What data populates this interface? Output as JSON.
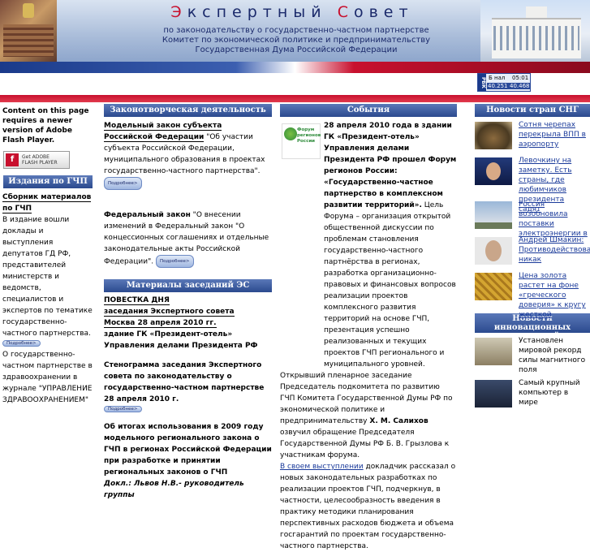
{
  "header": {
    "title_a": "Э",
    "title_mid": "кспертный ",
    "title_b": "С",
    "title_end": "овет",
    "sub1": "по законодательству о государственно-частном партнерстве",
    "sub2": "Комитет по экономической политике и предпринимательству",
    "sub3": "Государственная Дума Российской Федерации"
  },
  "ticker": {
    "logo": "РБК",
    "c1": "Б нал",
    "c2": "05:01",
    "c3": "40.251",
    "c4": "40.468"
  },
  "more_label": "Подробнее>",
  "left": {
    "flash_text": "Content on this page requires a newer version of Adobe Flash Player.",
    "get_flash_1": "Get ADOBE",
    "get_flash_2": "FLASH PLAYER",
    "header": "Издания по ГЧП",
    "item1_title": "Сборник материалов по ГЧП",
    "item1_text": "В издание вошли доклады и выступления депутатов ГД РФ, представителей министерств и ведомств, специалистов и экспертов по тематике государственно-частного партнерства.",
    "item2_text": "О государственно-частном партнерстве в здравоохранении в журнале \"УПРАВЛЕНИЕ ЗДРАВООХРАНЕНИЕМ\""
  },
  "col2": {
    "header": "Законотворческая деятельность",
    "law1_bold": "Модельный закон субъекта Российской Федерации",
    "law1_text": " \"Об участии субъекта Российской Федерации, муниципального образования в проектах государственно-частного партнерства\".",
    "law2_bold": "Федеральный закон",
    "law2_text": " \"О внесении изменений в Федеральный закон \"О концессионных соглашениях и отдельные законодательные акты Российской Федерации\".",
    "header2": "Материалы заседаний ЭС",
    "agenda_title": "ПОВЕСТКА ДНЯ",
    "agenda_l1": "заседания Экспертного совета",
    "agenda_l2": "Москва 28 апреля 2010 гг.",
    "agenda_l3": "здание ГК «Президент-отель» Управления делами Президента РФ",
    "steno": "Стенограмма заседания Экспертного совета по законодательству о государственно-частном партнерстве 28 апреля 2010 г.",
    "results": "Об итогах использования в 2009 году модельного регионального закона о ГЧП в регионах Российской Федерации при разработке и принятии региональных законов о ГЧП",
    "report": "Докл.: Львов Н.В.- руководитель группы"
  },
  "col3": {
    "header": "События",
    "forum_logo": "Форум регионов России",
    "event_bold": "28 апреля 2010 года в здании ГК «Президент-отель» Управления делами Президента РФ прошел Форум регионов России: «Государственно-частное партнерство в комплексном развитии территорий».",
    "event_text": " Цель Форума – организация открытой общественной дискуссии по проблемам становления государственно-частного партнёрства в регионах, разработка организационно-правовых и финансовых вопросов реализации проектов комплексного развития территорий на основе ГЧП, презентация успешно реализованных и текущих проектов ГЧП регионального и муниципального уровней.",
    "plenary_a": "Открывший пленарное заседание Председатель подкомитета по развитию ГЧП Комитета Государственной Думы РФ по экономической политике и предпринимательству ",
    "plenary_name": "Х. М. Салихов",
    "plenary_b": " озвучил обращение Председателя Государственной Думы РФ Б. В. Грызлова к участникам форума.",
    "speech_link": "В своем выступлении",
    "speech_text": " докладчик рассказал о новых законодательных разработках по реализации проектов ГЧП, подчеркнув, в частности, целесообразность введения в практику методики планирования перспективных расходов бюджета и объема госгарантий по проектам государственно-частного партнерства."
  },
  "col4": {
    "header": "Новости стран СНГ",
    "news": [
      "Сотня черепах перекрыла ВПП в аэропорту",
      "Левочкину на заметку. Есть страны, где любимчиков президента садят",
      "Россия возобновила поставки электроэнергии в",
      "Андрей Шмакин: Противодействовать никак",
      "Цена золота растет на фоне «греческого доверия» к кругу жесткой"
    ],
    "header2": "Новости инновационных технологий",
    "tech": [
      "Установлен мировой рекорд силы магнитного поля",
      "Самый крупный компьютер в мире"
    ]
  },
  "colors": {
    "header_blue": "#1b2a6b",
    "accent_red": "#c8102e",
    "col_header": "#2b4a8e"
  }
}
